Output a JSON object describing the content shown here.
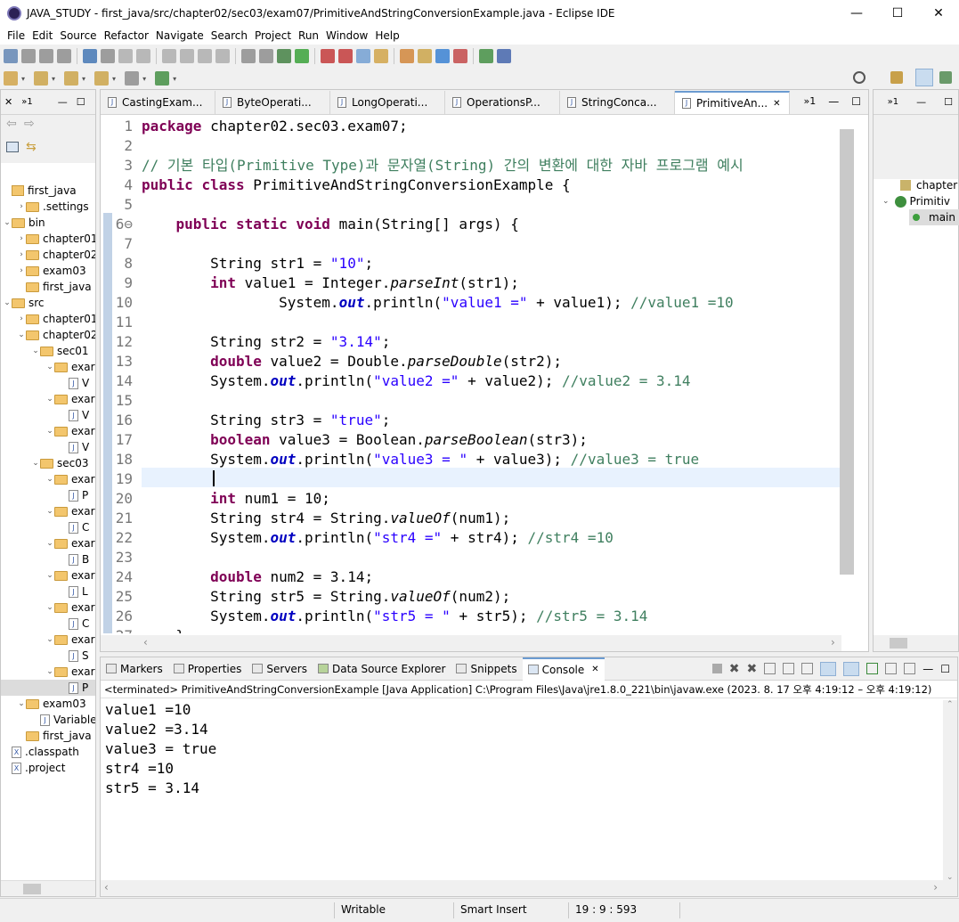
{
  "window": {
    "title": "JAVA_STUDY - first_java/src/chapter02/sec03/exam07/PrimitiveAndStringConversionExample.java - Eclipse IDE",
    "minimize": "—",
    "maximize": "☐",
    "close": "✕"
  },
  "menu": [
    "File",
    "Edit",
    "Source",
    "Refactor",
    "Navigate",
    "Search",
    "Project",
    "Run",
    "Window",
    "Help"
  ],
  "left": {
    "tree": [
      {
        "label": "first_java",
        "indent": 0,
        "kind": "project",
        "tw": ""
      },
      {
        "label": ".settings",
        "indent": 1,
        "kind": "folder",
        "tw": "›"
      },
      {
        "label": "bin",
        "indent": 0,
        "kind": "folder",
        "tw": "⌄"
      },
      {
        "label": "chapter01",
        "indent": 1,
        "kind": "folder",
        "tw": "›"
      },
      {
        "label": "chapter02",
        "indent": 1,
        "kind": "folder",
        "tw": "›"
      },
      {
        "label": "exam03",
        "indent": 1,
        "kind": "folder",
        "tw": "›"
      },
      {
        "label": "first_java",
        "indent": 1,
        "kind": "folder",
        "tw": ""
      },
      {
        "label": "src",
        "indent": 0,
        "kind": "folder",
        "tw": "⌄"
      },
      {
        "label": "chapter01",
        "indent": 1,
        "kind": "folder",
        "tw": "›"
      },
      {
        "label": "chapter02",
        "indent": 1,
        "kind": "folder",
        "tw": "⌄"
      },
      {
        "label": "sec01",
        "indent": 2,
        "kind": "folder",
        "tw": "⌄"
      },
      {
        "label": "exar",
        "indent": 3,
        "kind": "folder",
        "tw": "⌄"
      },
      {
        "label": "V",
        "indent": 4,
        "kind": "java",
        "tw": ""
      },
      {
        "label": "exar",
        "indent": 3,
        "kind": "folder",
        "tw": "⌄"
      },
      {
        "label": "V",
        "indent": 4,
        "kind": "java",
        "tw": ""
      },
      {
        "label": "exar",
        "indent": 3,
        "kind": "folder",
        "tw": "⌄"
      },
      {
        "label": "V",
        "indent": 4,
        "kind": "java",
        "tw": ""
      },
      {
        "label": "sec03",
        "indent": 2,
        "kind": "folder",
        "tw": "⌄"
      },
      {
        "label": "exar",
        "indent": 3,
        "kind": "folder",
        "tw": "⌄"
      },
      {
        "label": "P",
        "indent": 4,
        "kind": "java",
        "tw": ""
      },
      {
        "label": "exar",
        "indent": 3,
        "kind": "folder",
        "tw": "⌄"
      },
      {
        "label": "C",
        "indent": 4,
        "kind": "java",
        "tw": ""
      },
      {
        "label": "exar",
        "indent": 3,
        "kind": "folder",
        "tw": "⌄"
      },
      {
        "label": "B",
        "indent": 4,
        "kind": "java",
        "tw": ""
      },
      {
        "label": "exar",
        "indent": 3,
        "kind": "folder",
        "tw": "⌄"
      },
      {
        "label": "L",
        "indent": 4,
        "kind": "java",
        "tw": ""
      },
      {
        "label": "exar",
        "indent": 3,
        "kind": "folder",
        "tw": "⌄"
      },
      {
        "label": "C",
        "indent": 4,
        "kind": "java",
        "tw": ""
      },
      {
        "label": "exar",
        "indent": 3,
        "kind": "folder",
        "tw": "⌄"
      },
      {
        "label": "S",
        "indent": 4,
        "kind": "java",
        "tw": ""
      },
      {
        "label": "exar",
        "indent": 3,
        "kind": "folder",
        "tw": "⌄"
      },
      {
        "label": "P",
        "indent": 4,
        "kind": "java",
        "tw": "",
        "selected": true
      },
      {
        "label": "exam03",
        "indent": 1,
        "kind": "folder",
        "tw": "⌄"
      },
      {
        "label": "Variable",
        "indent": 2,
        "kind": "java",
        "tw": ""
      },
      {
        "label": "first_java",
        "indent": 1,
        "kind": "folder",
        "tw": ""
      },
      {
        "label": ".classpath",
        "indent": 0,
        "kind": "xml",
        "tw": ""
      },
      {
        "label": ".project",
        "indent": 0,
        "kind": "xml",
        "tw": ""
      }
    ]
  },
  "editor": {
    "tabs": [
      {
        "label": "CastingExam...",
        "active": false
      },
      {
        "label": "ByteOperati...",
        "active": false
      },
      {
        "label": "LongOperati...",
        "active": false
      },
      {
        "label": "OperationsP...",
        "active": false
      },
      {
        "label": "StringConca...",
        "active": false
      },
      {
        "label": "PrimitiveAn...",
        "active": true
      }
    ],
    "overflow": "»1",
    "lines": [
      {
        "n": "1",
        "t": "package chapter02.sec03.exam07;"
      },
      {
        "n": "2",
        "t": ""
      },
      {
        "n": "3",
        "t": "// 기본 타입(Primitive Type)과 문자열(String) 간의 변환에 대한 자바 프로그램 예시"
      },
      {
        "n": "4",
        "t": "public class PrimitiveAndStringConversionExample {"
      },
      {
        "n": "5",
        "t": ""
      },
      {
        "n": "6⊖",
        "t": "    public static void main(String[] args) {"
      },
      {
        "n": "7",
        "t": ""
      },
      {
        "n": "8",
        "t": "        String str1 = \"10\";"
      },
      {
        "n": "9",
        "t": "        int value1 = Integer.parseInt(str1);"
      },
      {
        "n": "10",
        "t": "                System.out.println(\"value1 =\" + value1); //value1 =10"
      },
      {
        "n": "11",
        "t": ""
      },
      {
        "n": "12",
        "t": "        String str2 = \"3.14\";"
      },
      {
        "n": "13",
        "t": "        double value2 = Double.parseDouble(str2);"
      },
      {
        "n": "14",
        "t": "        System.out.println(\"value2 =\" + value2); //value2 = 3.14"
      },
      {
        "n": "15",
        "t": ""
      },
      {
        "n": "16",
        "t": "        String str3 = \"true\";"
      },
      {
        "n": "17",
        "t": "        boolean value3 = Boolean.parseBoolean(str3);"
      },
      {
        "n": "18",
        "t": "        System.out.println(\"value3 = \" + value3); //value3 = true"
      },
      {
        "n": "19",
        "t": "        "
      },
      {
        "n": "20",
        "t": "        int num1 = 10;"
      },
      {
        "n": "21",
        "t": "        String str4 = String.valueOf(num1);"
      },
      {
        "n": "22",
        "t": "        System.out.println(\"str4 =\" + str4); //str4 =10"
      },
      {
        "n": "23",
        "t": ""
      },
      {
        "n": "24",
        "t": "        double num2 = 3.14;"
      },
      {
        "n": "25",
        "t": "        String str5 = String.valueOf(num2);"
      },
      {
        "n": "26",
        "t": "        System.out.println(\"str5 = \" + str5); //str5 = 3.14"
      },
      {
        "n": "27",
        "t": "    }"
      }
    ]
  },
  "outline": {
    "items": [
      "chapter",
      "Primitiv",
      "main"
    ]
  },
  "console": {
    "tabs": [
      "Markers",
      "Properties",
      "Servers",
      "Data Source Explorer",
      "Snippets",
      "Console"
    ],
    "terminated": "<terminated> PrimitiveAndStringConversionExample [Java Application] C:\\Program Files\\Java\\jre1.8.0_221\\bin\\javaw.exe  (2023. 8. 17 오후 4:19:12 – 오후 4:19:12)",
    "output": [
      "value1 =10",
      "value2 =3.14",
      "value3 = true",
      "str4 =10",
      "str5 = 3.14"
    ]
  },
  "status": {
    "writable": "Writable",
    "insert": "Smart Insert",
    "position": "19 : 9 : 593"
  }
}
